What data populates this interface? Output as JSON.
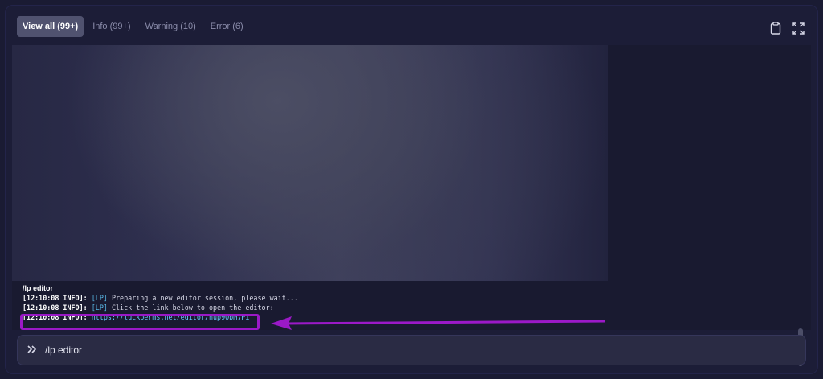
{
  "tabs": [
    {
      "label": "View all (99+)",
      "active": true
    },
    {
      "label": "Info (99+)",
      "active": false
    },
    {
      "label": "Warning (10)",
      "active": false
    },
    {
      "label": "Error (6)",
      "active": false
    }
  ],
  "toolbar": {
    "copy_icon": "clipboard-icon",
    "fullscreen_icon": "expand-icon"
  },
  "console": {
    "lines": [
      {
        "command": "/lp editor"
      },
      {
        "timestamp": "[12:10:08 INFO]:",
        "tag": "[LP]",
        "text": "Preparing a new editor session, please wait..."
      },
      {
        "timestamp": "[12:10:08 INFO]:",
        "tag": "[LP]",
        "text": "Click the link below to open the editor:"
      },
      {
        "timestamp": "[12:10:08 INFO]:",
        "link": "https://luckperms.net/editor/nup9ObM7Pi"
      }
    ]
  },
  "input": {
    "icon": "chevrons-right-icon",
    "value": "/lp editor"
  },
  "colors": {
    "accent": "#9b19c7",
    "background": "#1c1d37",
    "link": "#66c8ff"
  }
}
